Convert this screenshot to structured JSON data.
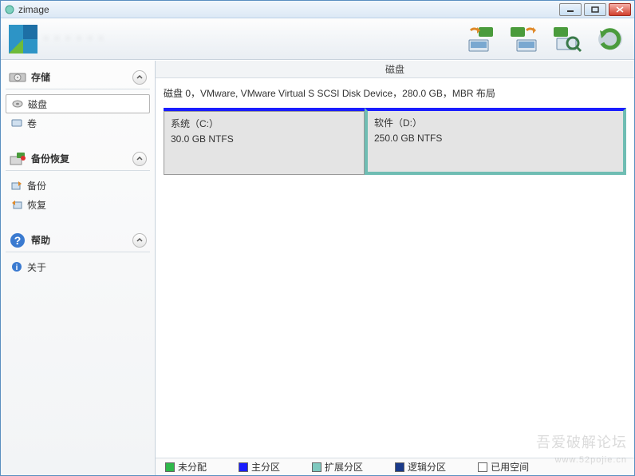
{
  "app": {
    "title": "zimage"
  },
  "logo": {
    "blurred_text": "· · · · · ·"
  },
  "toolbar_icons": [
    "backup-to",
    "restore-from",
    "search-disk",
    "refresh"
  ],
  "sidebar": {
    "storage": {
      "title": "存储",
      "items": [
        {
          "label": "磁盘",
          "selected": true
        },
        {
          "label": "卷",
          "selected": false
        }
      ]
    },
    "backup": {
      "title": "备份恢复",
      "items": [
        {
          "label": "备份"
        },
        {
          "label": "恢复"
        }
      ]
    },
    "help": {
      "title": "帮助",
      "items": [
        {
          "label": "关于"
        }
      ]
    }
  },
  "main": {
    "header": "磁盘",
    "disk_line": "磁盘 0，VMware, VMware Virtual S SCSI Disk Device，280.0 GB，MBR 布局",
    "partitions": [
      {
        "name": "系统（C:）",
        "size": "30.0 GB NTFS",
        "selected": false
      },
      {
        "name": "软件（D:）",
        "size": "250.0 GB NTFS",
        "selected": true
      }
    ]
  },
  "legend": [
    {
      "label": "未分配",
      "color": "#2fb84a"
    },
    {
      "label": "主分区",
      "color": "#1a1dff"
    },
    {
      "label": "扩展分区",
      "color": "#7fc9bf"
    },
    {
      "label": "逻辑分区",
      "color": "#1a3a8a"
    },
    {
      "label": "已用空间",
      "color": "#ffffff"
    }
  ],
  "watermark": {
    "main": "吾爱破解论坛",
    "sub": "www.52pojie.cn"
  }
}
